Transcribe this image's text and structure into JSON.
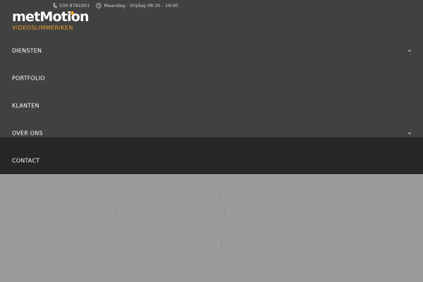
{
  "header": {
    "logo_text": "metMotion",
    "logo_tagline": "VIDEOSLIMMERIKEN",
    "phone": "030 8781901",
    "hours": "Maandag - Vrijdag 08:30 - 19:00"
  },
  "nav": {
    "items": [
      {
        "label": "DIENSTEN",
        "has_submenu": true
      },
      {
        "label": "PORTFOLIO",
        "has_submenu": false
      },
      {
        "label": "KLANTEN",
        "has_submenu": false
      },
      {
        "label": "OVER ONS",
        "has_submenu": true
      },
      {
        "label": "CONTACT",
        "has_submenu": false
      }
    ]
  },
  "colors": {
    "menu_bg": "#414141",
    "contact_bg": "#272727",
    "page_bg": "#9b9b9b",
    "accent": "#f0a030"
  },
  "icons": {
    "phone": "phone-icon",
    "clock": "clock-icon",
    "submenu": "chevron-down-icon"
  }
}
